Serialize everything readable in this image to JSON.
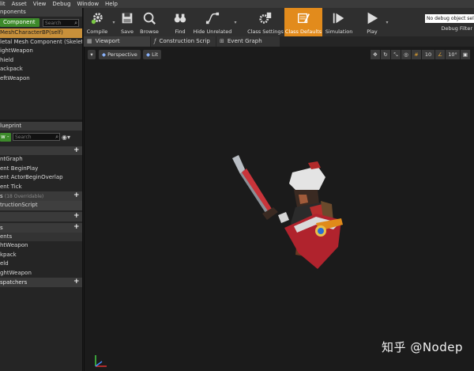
{
  "menu": [
    "lit",
    "Asset",
    "View",
    "Debug",
    "Window",
    "Help"
  ],
  "components": {
    "tab_title": "nponents",
    "add_button": "Component -",
    "search_placeholder": "Search",
    "selected": "MeshCharacterBP(self)",
    "items": [
      "letal Mesh Component (SkeletalMe",
      "ightWeapon",
      "hield",
      "ackpack",
      "eftWeapon"
    ]
  },
  "blueprint": {
    "tab_title": "lueprint",
    "add_button": "w -",
    "search_placeholder": "Search",
    "graphs_items": [
      "ntGraph",
      "ent BeginPlay",
      "ent ActorBeginOverlap",
      "ent Tick"
    ],
    "functions_header": "s",
    "functions_overridable": "(18 Overridable)",
    "functions_items": [
      "tructionScript"
    ],
    "macros_header": "",
    "variables_header": "s",
    "components_header": "ents",
    "variables_items": [
      "htWeapon",
      "kpack",
      "eld",
      "ghtWeapon"
    ],
    "dispatchers_header": "spatchers"
  },
  "toolbar": {
    "buttons": [
      {
        "label": "Compile",
        "icon": "compile-gear-icon"
      },
      {
        "label": "Save",
        "icon": "save-icon"
      },
      {
        "label": "Browse",
        "icon": "browse-icon"
      },
      {
        "label": "Find",
        "icon": "binoculars-icon"
      },
      {
        "label": "Hide Unrelated",
        "icon": "hide-unrelated-icon"
      },
      {
        "label": "Class Settings",
        "icon": "class-settings-icon"
      },
      {
        "label": "Class Defaults",
        "icon": "class-defaults-icon"
      },
      {
        "label": "Simulation",
        "icon": "simulation-icon"
      },
      {
        "label": "Play",
        "icon": "play-icon"
      }
    ],
    "debug_object": "No debug object sel",
    "debug_filter": "Debug Filter"
  },
  "tabs": [
    {
      "label": "Viewport",
      "icon": "viewport-tab-icon"
    },
    {
      "label": "Construction Scrip",
      "icon": "function-tab-icon"
    },
    {
      "label": "Event Graph",
      "icon": "graph-tab-icon"
    }
  ],
  "viewport": {
    "view_mode": "Perspective",
    "lighting": "Lit",
    "grid_snap": "10",
    "rotation_snap": "10°",
    "watermark": "知乎 @Nodep"
  },
  "colors": {
    "accent_orange": "#e28b1c",
    "add_green": "#3d8a2b",
    "selection": "#c8903a"
  }
}
